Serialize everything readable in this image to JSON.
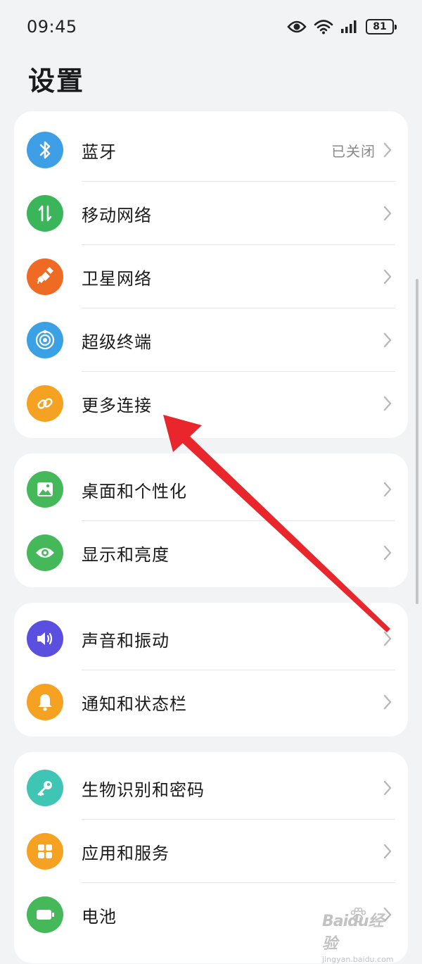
{
  "status_bar": {
    "time": "09:45",
    "icons": [
      "eye-icon",
      "wifi-icon",
      "signal-icon",
      "battery-icon"
    ],
    "battery_level": "81"
  },
  "page": {
    "title": "设置"
  },
  "groups": [
    {
      "items": [
        {
          "label": "蓝牙",
          "value": "已关闭",
          "icon": "bluetooth-icon",
          "color": "#3f9fe6"
        },
        {
          "label": "移动网络",
          "value": "",
          "icon": "mobile-data-icon",
          "color": "#3bb55a"
        },
        {
          "label": "卫星网络",
          "value": "",
          "icon": "satellite-icon",
          "color": "#ef6b24"
        },
        {
          "label": "超级终端",
          "value": "",
          "icon": "super-device-icon",
          "color": "#3aa2e4"
        },
        {
          "label": "更多连接",
          "value": "",
          "icon": "link-icon",
          "color": "#f5a222"
        }
      ]
    },
    {
      "items": [
        {
          "label": "桌面和个性化",
          "value": "",
          "icon": "image-icon",
          "color": "#45b85a"
        },
        {
          "label": "显示和亮度",
          "value": "",
          "icon": "eye-display-icon",
          "color": "#45b85a"
        }
      ]
    },
    {
      "items": [
        {
          "label": "声音和振动",
          "value": "",
          "icon": "speaker-icon",
          "color": "#5b4fe0"
        },
        {
          "label": "通知和状态栏",
          "value": "",
          "icon": "bell-icon",
          "color": "#f5a222"
        }
      ]
    },
    {
      "items": [
        {
          "label": "生物识别和密码",
          "value": "",
          "icon": "key-icon",
          "color": "#3ec5b3"
        },
        {
          "label": "应用和服务",
          "value": "",
          "icon": "apps-grid-icon",
          "color": "#f5a222"
        },
        {
          "label": "电池",
          "value": "",
          "icon": "battery-setting-icon",
          "color": "#45b85a"
        }
      ]
    }
  ],
  "annotation": {
    "arrow_color": "#e8262b"
  },
  "watermark": {
    "logo": "Baidu经验",
    "url": "jingyan.baidu.com"
  }
}
